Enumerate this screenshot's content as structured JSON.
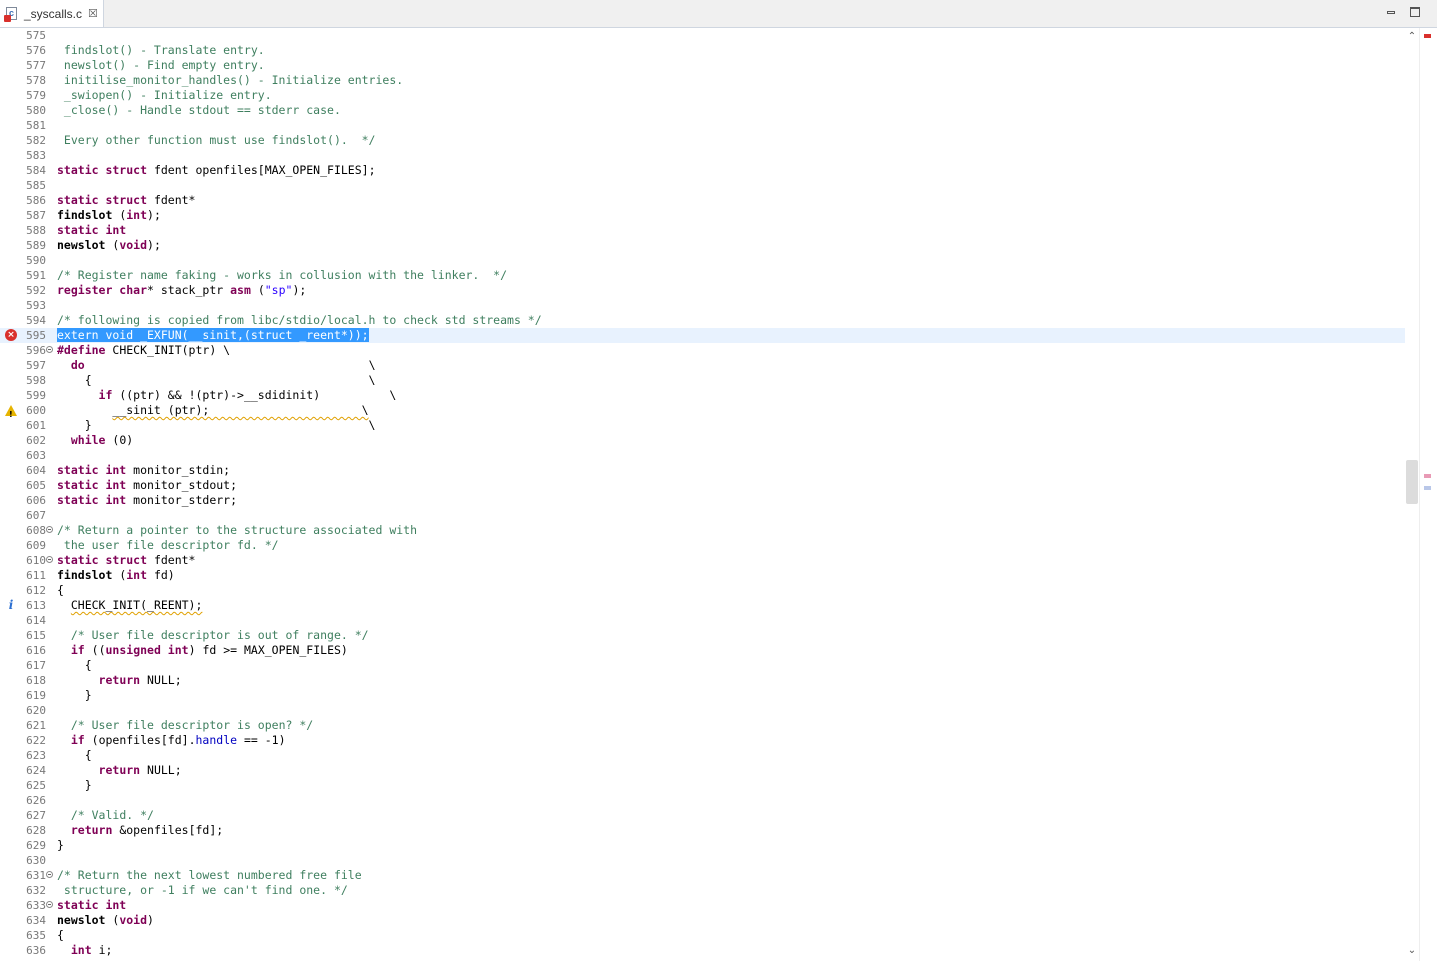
{
  "tab": {
    "title": "_syscalls.c",
    "close_glyph": "☒"
  },
  "window_controls": {
    "minimize_icon": "minimize-icon",
    "maximize_icon": "maximize-icon"
  },
  "scrollbar": {
    "up_arrow": "⌃",
    "down_arrow": "⌄"
  },
  "colors": {
    "keyword": "#7f0055",
    "comment": "#3f7f5f",
    "string": "#2a00ff",
    "selection": "#3399ff",
    "error": "#d9302c",
    "warning": "#e6b400",
    "info": "#2b6fd1"
  },
  "lines": [
    {
      "n": "575",
      "segs": []
    },
    {
      "n": "576",
      "segs": [
        {
          "t": " findslot() - Translate entry.",
          "c": "cm"
        }
      ]
    },
    {
      "n": "577",
      "segs": [
        {
          "t": " newslot() - Find empty entry.",
          "c": "cm"
        }
      ]
    },
    {
      "n": "578",
      "segs": [
        {
          "t": " initilise_monitor_handles() - Initialize entries.",
          "c": "cm"
        }
      ]
    },
    {
      "n": "579",
      "segs": [
        {
          "t": " _swiopen() - Initialize entry.",
          "c": "cm"
        }
      ]
    },
    {
      "n": "580",
      "segs": [
        {
          "t": " _close() - Handle stdout == stderr case.",
          "c": "cm"
        }
      ]
    },
    {
      "n": "581",
      "segs": []
    },
    {
      "n": "582",
      "segs": [
        {
          "t": " Every other function must use findslot().  */",
          "c": "cm"
        }
      ]
    },
    {
      "n": "583",
      "segs": []
    },
    {
      "n": "584",
      "segs": [
        {
          "t": "static struct",
          "c": "kw"
        },
        {
          "t": " fdent openfiles[MAX_OPEN_FILES];"
        }
      ]
    },
    {
      "n": "585",
      "segs": []
    },
    {
      "n": "586",
      "segs": [
        {
          "t": "static struct",
          "c": "kw"
        },
        {
          "t": " fdent*"
        }
      ]
    },
    {
      "n": "587",
      "segs": [
        {
          "t": "findslot",
          "c": "b"
        },
        {
          "t": " ("
        },
        {
          "t": "int",
          "c": "kw"
        },
        {
          "t": ");"
        }
      ]
    },
    {
      "n": "588",
      "segs": [
        {
          "t": "static int",
          "c": "kw"
        }
      ]
    },
    {
      "n": "589",
      "segs": [
        {
          "t": "newslot",
          "c": "b"
        },
        {
          "t": " ("
        },
        {
          "t": "void",
          "c": "kw"
        },
        {
          "t": ");"
        }
      ]
    },
    {
      "n": "590",
      "segs": []
    },
    {
      "n": "591",
      "segs": [
        {
          "t": "/* Register name faking - works in collusion with the linker.  */",
          "c": "cm"
        }
      ]
    },
    {
      "n": "592",
      "segs": [
        {
          "t": "register char",
          "c": "kw"
        },
        {
          "t": "* stack_ptr "
        },
        {
          "t": "asm",
          "c": "kw"
        },
        {
          "t": " ("
        },
        {
          "t": "\"sp\"",
          "c": "str"
        },
        {
          "t": ");"
        }
      ]
    },
    {
      "n": "593",
      "segs": []
    },
    {
      "n": "594",
      "segs": [
        {
          "t": "/* following is copied from libc/stdio/local.h to check std streams */",
          "c": "cm"
        }
      ]
    },
    {
      "n": "595",
      "marker": "error",
      "selected": true,
      "segs": [
        {
          "t": "extern void _EXFUN(__sinit,(struct _reent*));",
          "c": "sel"
        }
      ]
    },
    {
      "n": "596",
      "fold": true,
      "segs": [
        {
          "t": "#define",
          "c": "kw"
        },
        {
          "t": " CHECK_INIT(ptr) \\"
        }
      ]
    },
    {
      "n": "597",
      "segs": [
        {
          "t": "  "
        },
        {
          "t": "do",
          "c": "kw"
        },
        {
          "t": "                                         \\"
        }
      ]
    },
    {
      "n": "598",
      "segs": [
        {
          "t": "    {                                        \\"
        }
      ]
    },
    {
      "n": "599",
      "segs": [
        {
          "t": "      "
        },
        {
          "t": "if",
          "c": "kw"
        },
        {
          "t": " ((ptr) && !(ptr)->__sdidinit)          \\"
        }
      ]
    },
    {
      "n": "600",
      "marker": "warning",
      "segs": [
        {
          "t": "        "
        },
        {
          "t": "__sinit (ptr);                      \\",
          "c": "sq"
        }
      ]
    },
    {
      "n": "601",
      "segs": [
        {
          "t": "    }                                        \\"
        }
      ]
    },
    {
      "n": "602",
      "segs": [
        {
          "t": "  "
        },
        {
          "t": "while",
          "c": "kw"
        },
        {
          "t": " (0)"
        }
      ]
    },
    {
      "n": "603",
      "segs": []
    },
    {
      "n": "604",
      "segs": [
        {
          "t": "static int",
          "c": "kw"
        },
        {
          "t": " monitor_stdin;"
        }
      ]
    },
    {
      "n": "605",
      "segs": [
        {
          "t": "static int",
          "c": "kw"
        },
        {
          "t": " monitor_stdout;"
        }
      ]
    },
    {
      "n": "606",
      "segs": [
        {
          "t": "static int",
          "c": "kw"
        },
        {
          "t": " monitor_stderr;"
        }
      ]
    },
    {
      "n": "607",
      "segs": []
    },
    {
      "n": "608",
      "fold": true,
      "segs": [
        {
          "t": "/* Return a pointer to the structure associated with",
          "c": "cm"
        }
      ]
    },
    {
      "n": "609",
      "segs": [
        {
          "t": " the user file descriptor fd. */",
          "c": "cm"
        }
      ]
    },
    {
      "n": "610",
      "fold": true,
      "segs": [
        {
          "t": "static struct",
          "c": "kw"
        },
        {
          "t": " fdent*"
        }
      ]
    },
    {
      "n": "611",
      "segs": [
        {
          "t": "findslot",
          "c": "b"
        },
        {
          "t": " ("
        },
        {
          "t": "int",
          "c": "kw"
        },
        {
          "t": " fd)"
        }
      ]
    },
    {
      "n": "612",
      "segs": [
        {
          "t": "{"
        }
      ]
    },
    {
      "n": "613",
      "marker": "info",
      "segs": [
        {
          "t": "  "
        },
        {
          "t": "CHECK_INIT(_REENT);",
          "c": "sq"
        }
      ]
    },
    {
      "n": "614",
      "segs": []
    },
    {
      "n": "615",
      "segs": [
        {
          "t": "  "
        },
        {
          "t": "/* User file descriptor is out of range. */",
          "c": "cm"
        }
      ]
    },
    {
      "n": "616",
      "segs": [
        {
          "t": "  "
        },
        {
          "t": "if",
          "c": "kw"
        },
        {
          "t": " (("
        },
        {
          "t": "unsigned int",
          "c": "kw"
        },
        {
          "t": ") fd >= MAX_OPEN_FILES)"
        }
      ]
    },
    {
      "n": "617",
      "segs": [
        {
          "t": "    {"
        }
      ]
    },
    {
      "n": "618",
      "segs": [
        {
          "t": "      "
        },
        {
          "t": "return",
          "c": "kw"
        },
        {
          "t": " NULL;"
        }
      ]
    },
    {
      "n": "619",
      "segs": [
        {
          "t": "    }"
        }
      ]
    },
    {
      "n": "620",
      "segs": []
    },
    {
      "n": "621",
      "segs": [
        {
          "t": "  "
        },
        {
          "t": "/* User file descriptor is open? */",
          "c": "cm"
        }
      ]
    },
    {
      "n": "622",
      "segs": [
        {
          "t": "  "
        },
        {
          "t": "if",
          "c": "kw"
        },
        {
          "t": " (openfiles[fd]."
        },
        {
          "t": "handle",
          "c": "fld"
        },
        {
          "t": " == -1)"
        }
      ]
    },
    {
      "n": "623",
      "segs": [
        {
          "t": "    {"
        }
      ]
    },
    {
      "n": "624",
      "segs": [
        {
          "t": "      "
        },
        {
          "t": "return",
          "c": "kw"
        },
        {
          "t": " NULL;"
        }
      ]
    },
    {
      "n": "625",
      "segs": [
        {
          "t": "    }"
        }
      ]
    },
    {
      "n": "626",
      "segs": []
    },
    {
      "n": "627",
      "segs": [
        {
          "t": "  "
        },
        {
          "t": "/* Valid. */",
          "c": "cm"
        }
      ]
    },
    {
      "n": "628",
      "segs": [
        {
          "t": "  "
        },
        {
          "t": "return",
          "c": "kw"
        },
        {
          "t": " &openfiles[fd];"
        }
      ]
    },
    {
      "n": "629",
      "segs": [
        {
          "t": "}"
        }
      ]
    },
    {
      "n": "630",
      "segs": []
    },
    {
      "n": "631",
      "fold": true,
      "segs": [
        {
          "t": "/* Return the next lowest numbered free file",
          "c": "cm"
        }
      ]
    },
    {
      "n": "632",
      "segs": [
        {
          "t": " structure, or -1 if we can't find one. */",
          "c": "cm"
        }
      ]
    },
    {
      "n": "633",
      "fold": true,
      "segs": [
        {
          "t": "static int",
          "c": "kw"
        }
      ]
    },
    {
      "n": "634",
      "segs": [
        {
          "t": "newslot",
          "c": "b"
        },
        {
          "t": " ("
        },
        {
          "t": "void",
          "c": "kw"
        },
        {
          "t": ")"
        }
      ]
    },
    {
      "n": "635",
      "segs": [
        {
          "t": "{"
        }
      ]
    },
    {
      "n": "636",
      "segs": [
        {
          "t": "  "
        },
        {
          "t": "int",
          "c": "kw"
        },
        {
          "t": " i;"
        }
      ]
    }
  ]
}
